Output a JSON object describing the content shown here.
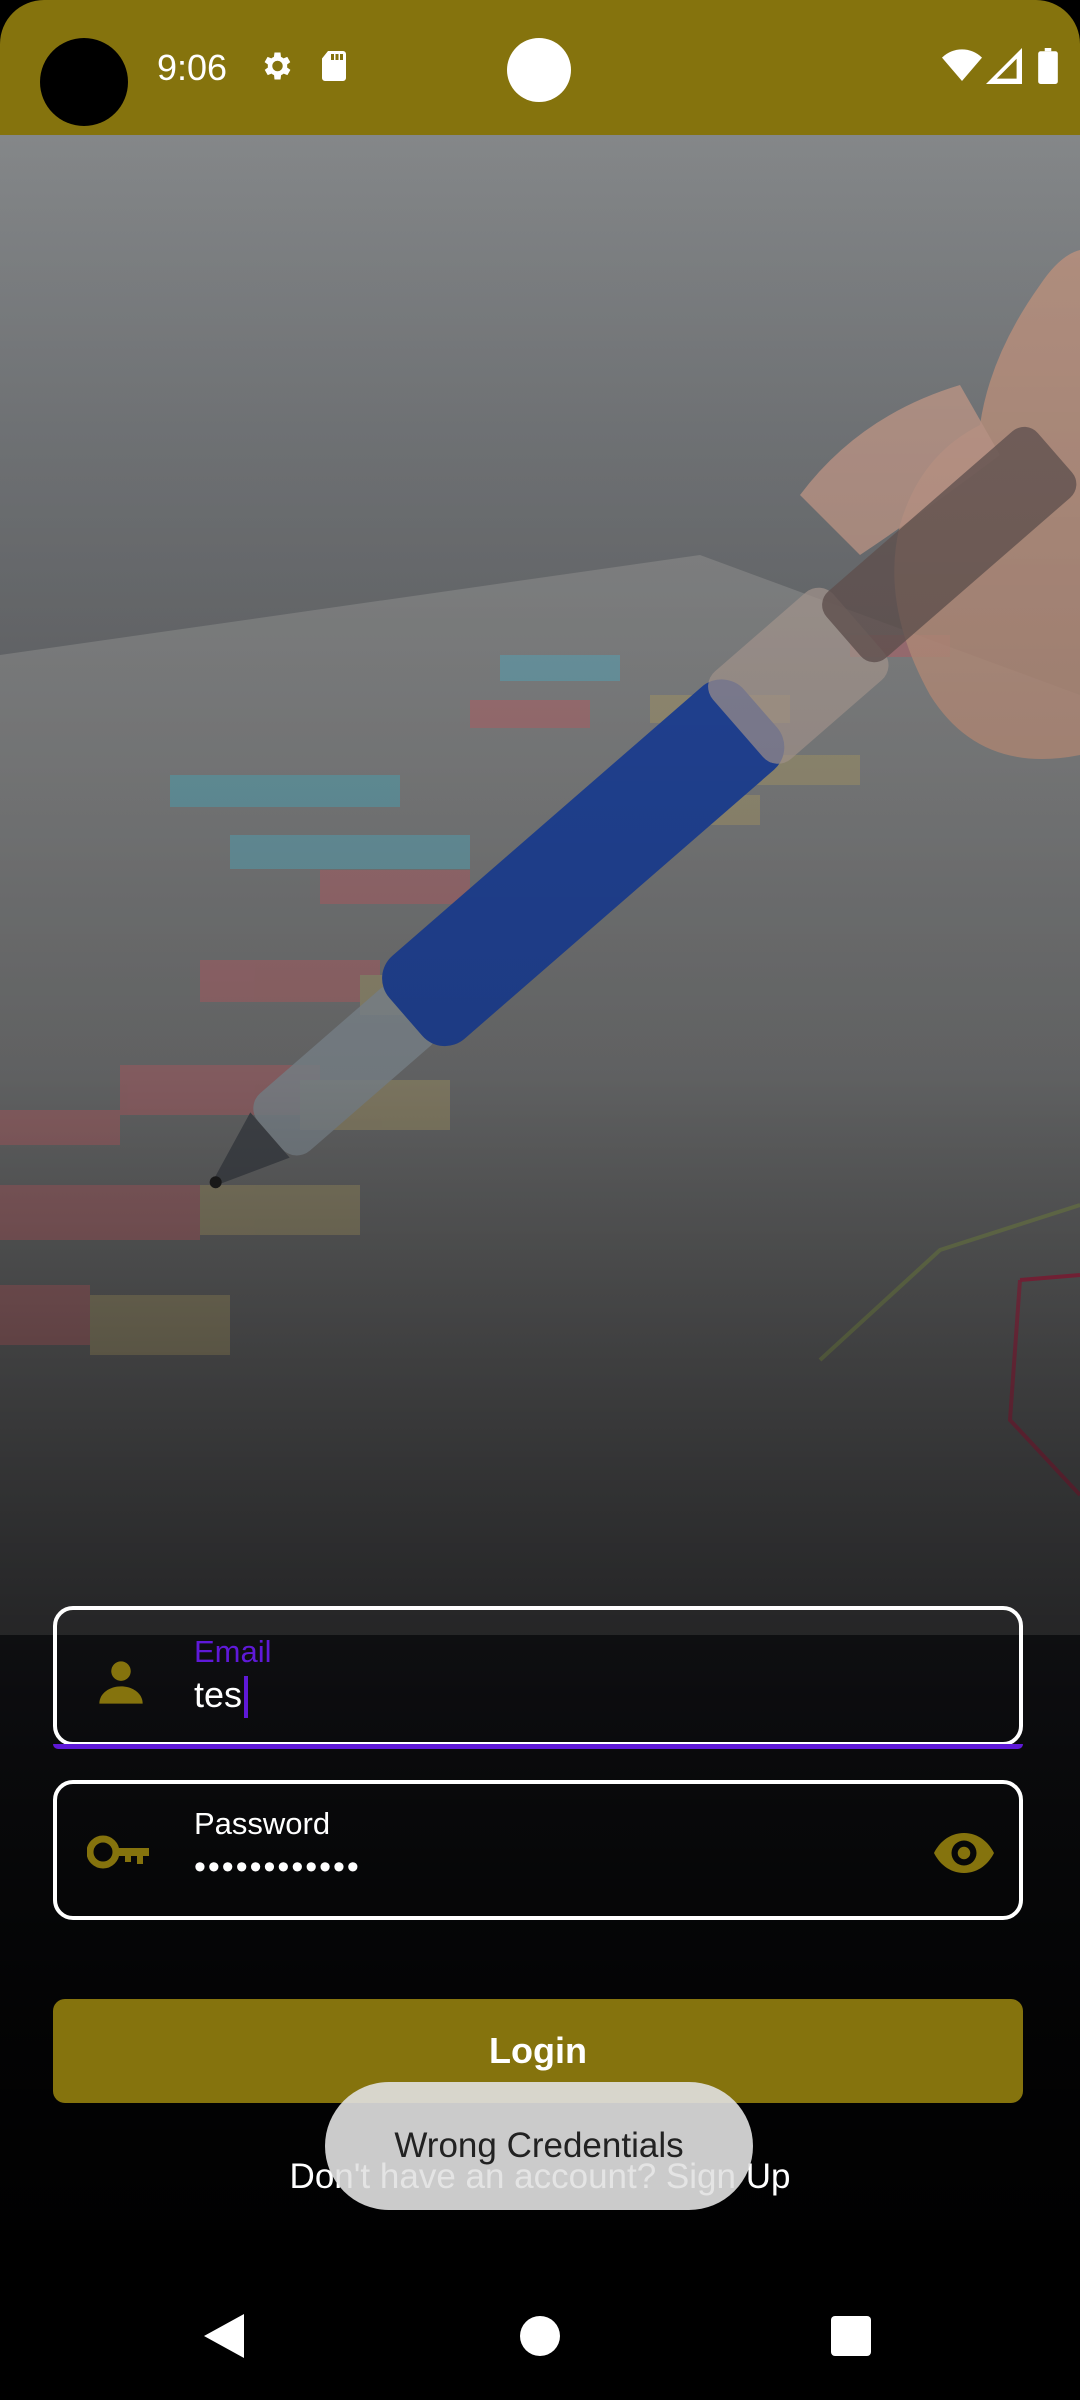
{
  "status_bar": {
    "time": "9:06",
    "icons": [
      "settings-icon",
      "sd-card-icon",
      "wifi-icon",
      "signal-icon",
      "battery-icon"
    ],
    "background": "#85730d"
  },
  "hero": {
    "description_icon": "pen-on-chart-photo"
  },
  "email_field": {
    "label": "Email",
    "value": "tes",
    "icon": "person-icon",
    "focus_color": "#5f19d8"
  },
  "password_field": {
    "label": "Password",
    "value": "••••••••••••",
    "leading_icon": "key-icon",
    "trailing_icon": "eye-icon"
  },
  "login_button": {
    "label": "Login",
    "color": "#85730d"
  },
  "signup_link": "Don't have an account? Sign Up",
  "toast": "Wrong Credentials",
  "nav_bar": [
    "back-icon",
    "home-icon",
    "recents-icon"
  ]
}
